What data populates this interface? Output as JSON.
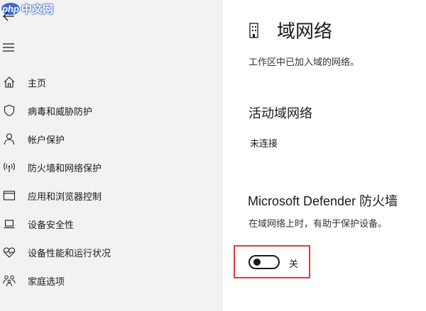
{
  "watermark": {
    "logo": "php",
    "text": "中文网"
  },
  "sidebar": {
    "items": [
      {
        "label": "主页",
        "icon": "home-icon"
      },
      {
        "label": "病毒和威胁防护",
        "icon": "shield-icon"
      },
      {
        "label": "帐户保护",
        "icon": "person-icon"
      },
      {
        "label": "防火墙和网络保护",
        "icon": "wireless-icon"
      },
      {
        "label": "应用和浏览器控制",
        "icon": "app-window-icon"
      },
      {
        "label": "设备安全性",
        "icon": "laptop-icon"
      },
      {
        "label": "设备性能和运行状况",
        "icon": "heart-pulse-icon"
      },
      {
        "label": "家庭选项",
        "icon": "family-icon"
      }
    ]
  },
  "main": {
    "title": "域网络",
    "description": "工作区中已加入域的网络。",
    "active_networks_heading": "活动域网络",
    "active_networks_status": "未连接",
    "firewall_heading": "Microsoft Defender 防火墙",
    "firewall_description": "在域网络上时，有助于保护设备。",
    "firewall_toggle": {
      "state": "off",
      "label": "关"
    }
  },
  "colors": {
    "highlight": "#e53935",
    "sidebar_bg": "#f2f2f2"
  }
}
